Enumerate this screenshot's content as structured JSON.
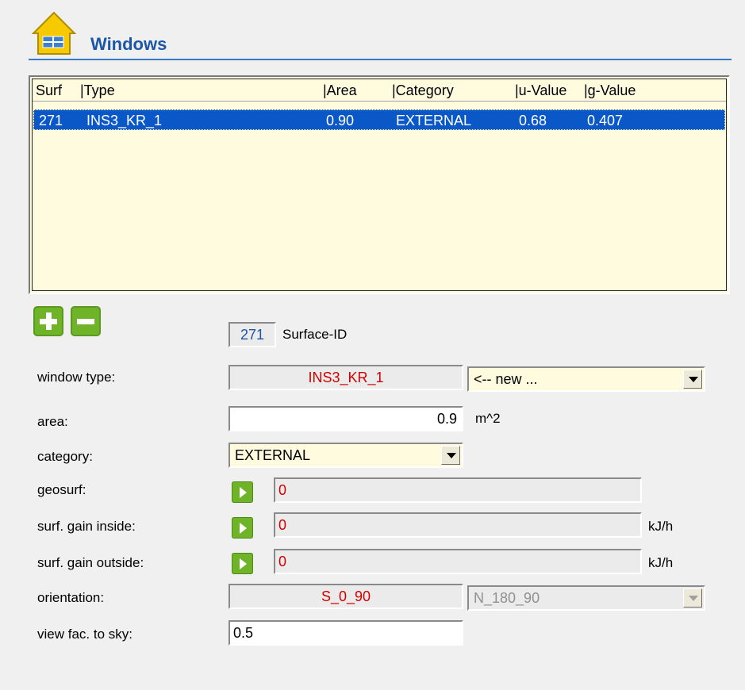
{
  "header": {
    "title": "Windows",
    "icon": "house-window-icon"
  },
  "list": {
    "columns": [
      "Surf",
      "|Type",
      "|Area",
      "|Category",
      "|u-Value",
      "|g-Value"
    ],
    "rows": [
      {
        "surf": "271",
        "type": "INS3_KR_1",
        "area": "0.90",
        "category": "EXTERNAL",
        "u_value": "0.68",
        "g_value": "0.407",
        "selected": true
      }
    ]
  },
  "buttons": {
    "add": "add-icon",
    "remove": "remove-icon"
  },
  "surface": {
    "id": "271",
    "label": "Surface-ID"
  },
  "form": {
    "window_type": {
      "label": "window type:",
      "value": "INS3_KR_1",
      "select_value": "<-- new ..."
    },
    "area": {
      "label": "area:",
      "value": "0.9",
      "unit": "m^2"
    },
    "category": {
      "label": "category:",
      "value": "EXTERNAL"
    },
    "geosurf": {
      "label": "geosurf:",
      "value": "0"
    },
    "gain_inside": {
      "label": "surf. gain inside:",
      "value": "0",
      "unit": "kJ/h"
    },
    "gain_outside": {
      "label": "surf. gain outside:",
      "value": "0",
      "unit": "kJ/h"
    },
    "orientation": {
      "label": "orientation:",
      "value": "S_0_90",
      "select_value": "N_180_90"
    },
    "view_factor": {
      "label": "view fac. to sky:",
      "value": "0.5"
    }
  },
  "colors": {
    "accent": "#1c56a8",
    "selection": "#0a58c8",
    "list_bg": "#fffbdf",
    "green": "#6fb428",
    "value_red": "#d00000"
  }
}
